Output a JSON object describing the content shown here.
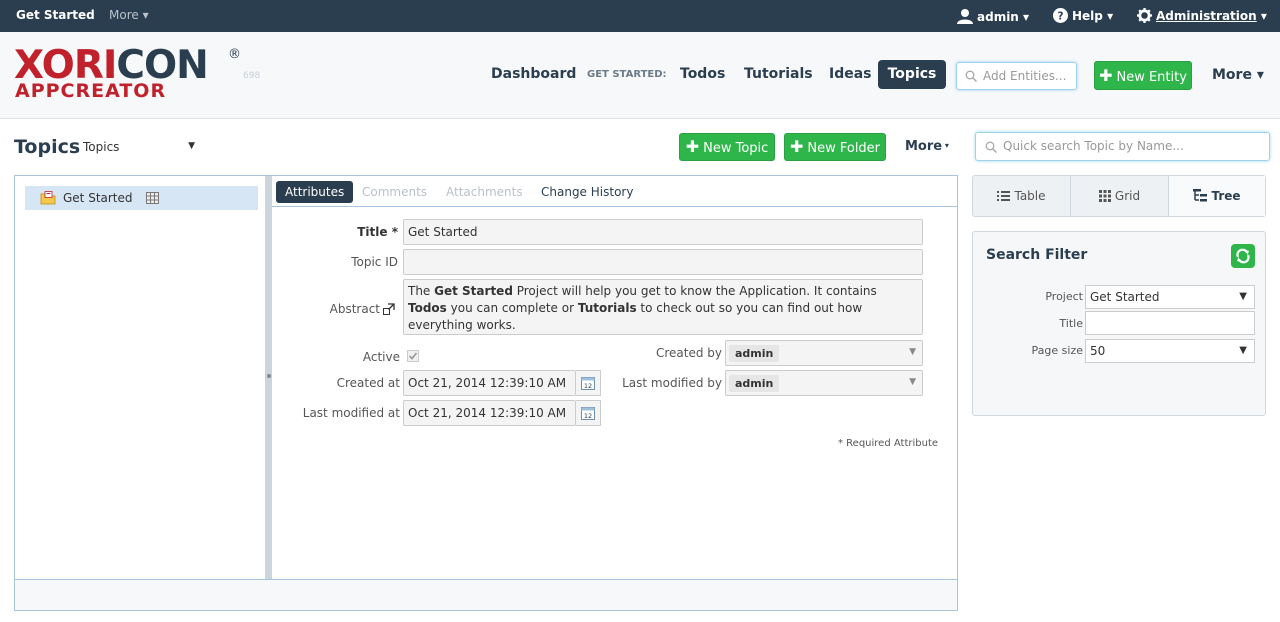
{
  "topbar": {
    "get_started": "Get Started",
    "more": "More ▾",
    "user": "admin ▾",
    "help": "Help ▾",
    "admin": "Administration",
    "admin_caret": " ▾"
  },
  "header": {
    "logo_main_a": "XORI",
    "logo_main_b": "CON",
    "logo_sub": "APPCREATOR",
    "logo_reg": "®",
    "version": "698",
    "nav": {
      "dashboard": "Dashboard",
      "get_started_label": "GET STARTED:",
      "todos": "Todos",
      "tutorials": "Tutorials",
      "ideas": "Ideas",
      "topics": "Topics"
    },
    "add_entities_placeholder": "Add Entities...",
    "new_entity": "New Entity",
    "more": "More ▾"
  },
  "page": {
    "title": "Topics",
    "selector": "Topics",
    "new_topic": "New Topic",
    "new_folder": "New Folder",
    "more": "More",
    "quick_search_placeholder": "Quick search Topic by Name..."
  },
  "tree": {
    "items": [
      {
        "label": "Get Started"
      }
    ]
  },
  "tabs": {
    "attributes": "Attributes",
    "comments": "Comments",
    "attachments": "Attachments",
    "change_history": "Change History"
  },
  "form": {
    "title_label": "Title *",
    "title_value": "Get Started",
    "topic_id_label": "Topic ID",
    "topic_id_value": "",
    "abstract_label": "Abstract",
    "abstract_value": {
      "p1": "The ",
      "b1": "Get Started",
      "p2": " Project will help you get to know the Application. It contains ",
      "b2": "Todos",
      "p3": " you can complete or ",
      "b3": "Tutorials",
      "p4": " to check out so you can find out how everything works."
    },
    "active_label": "Active",
    "active": true,
    "created_at_label": "Created at",
    "created_at_value": "Oct 21, 2014 12:39:10 AM",
    "last_modified_at_label": "Last modified at",
    "last_modified_at_value": "Oct 21, 2014 12:39:10 AM",
    "created_by_label": "Created by",
    "created_by_value": "admin",
    "last_modified_by_label": "Last modified by",
    "last_modified_by_value": "admin",
    "calendar_day": "12",
    "required_note": "* Required Attribute"
  },
  "views": {
    "table": "Table",
    "grid": "Grid",
    "tree": "Tree",
    "active": "Tree"
  },
  "search_filter": {
    "title": "Search Filter",
    "project_label": "Project",
    "project_value": "Get Started",
    "title_label": "Title",
    "title_value": "",
    "page_size_label": "Page size",
    "page_size_value": "50"
  },
  "colors": {
    "dark_navy": "#2b3e50",
    "brand_red": "#c0212a",
    "green": "#2eb64a",
    "selection": "#d7e6f5"
  }
}
